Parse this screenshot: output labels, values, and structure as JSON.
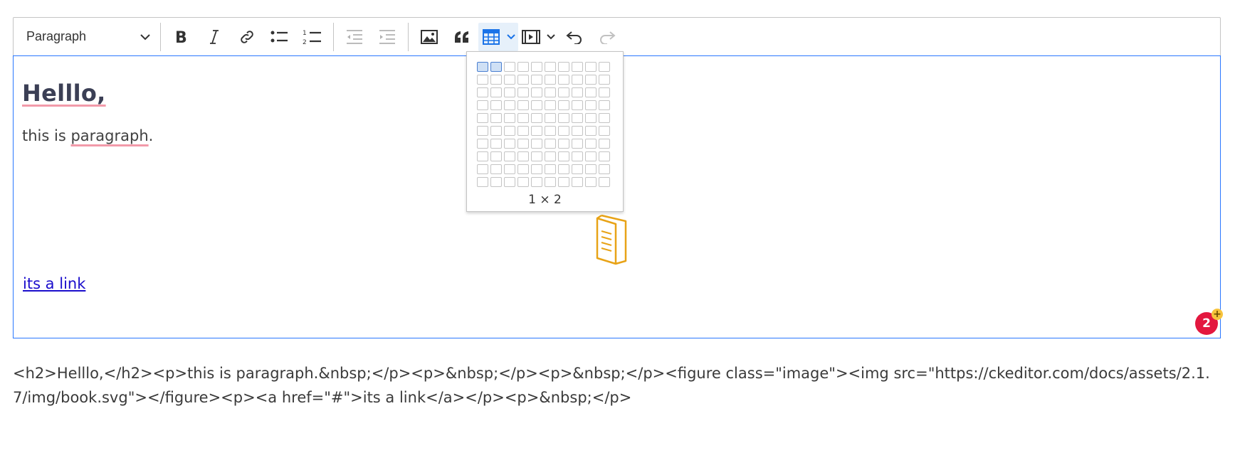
{
  "toolbar": {
    "heading_value": "Paragraph",
    "buttons": {
      "bold": "bold-icon",
      "italic": "italic-icon",
      "link": "link-icon",
      "bulleted_list": "bulleted-list-icon",
      "numbered_list": "numbered-list-icon",
      "outdent": "outdent-icon",
      "indent": "indent-icon",
      "image": "image-icon",
      "block_quote": "block-quote-icon",
      "insert_table": "table-icon",
      "media": "media-icon",
      "undo": "undo-icon",
      "redo": "redo-icon"
    },
    "accent_color": "#1a73e8"
  },
  "content": {
    "heading": "Helllo,",
    "paragraph_start": "this is ",
    "paragraph_misspelled": "paragraph",
    "paragraph_end": ".",
    "link_text": "its a link",
    "badge_count": "2",
    "badge_plus": "+"
  },
  "table_dropdown": {
    "rows": 10,
    "cols": 10,
    "highlight_rows": 1,
    "highlight_cols": 2,
    "size_label": "1 × 2"
  },
  "source_output": "<h2>Helllo,</h2><p>this is paragraph.&nbsp;</p><p>&nbsp;</p><p>&nbsp;</p><figure class=\"image\"><img src=\"https://ckeditor.com/docs/assets/2.1.7/img/book.svg\"></figure><p><a href=\"#\">its a link</a></p><p>&nbsp;</p>",
  "colors": {
    "focus_border": "#2977ff",
    "spell_underline": "#f29aa9",
    "badge": "#e3173f",
    "book_icon": "#e8a317",
    "link": "#1a0dcc"
  }
}
